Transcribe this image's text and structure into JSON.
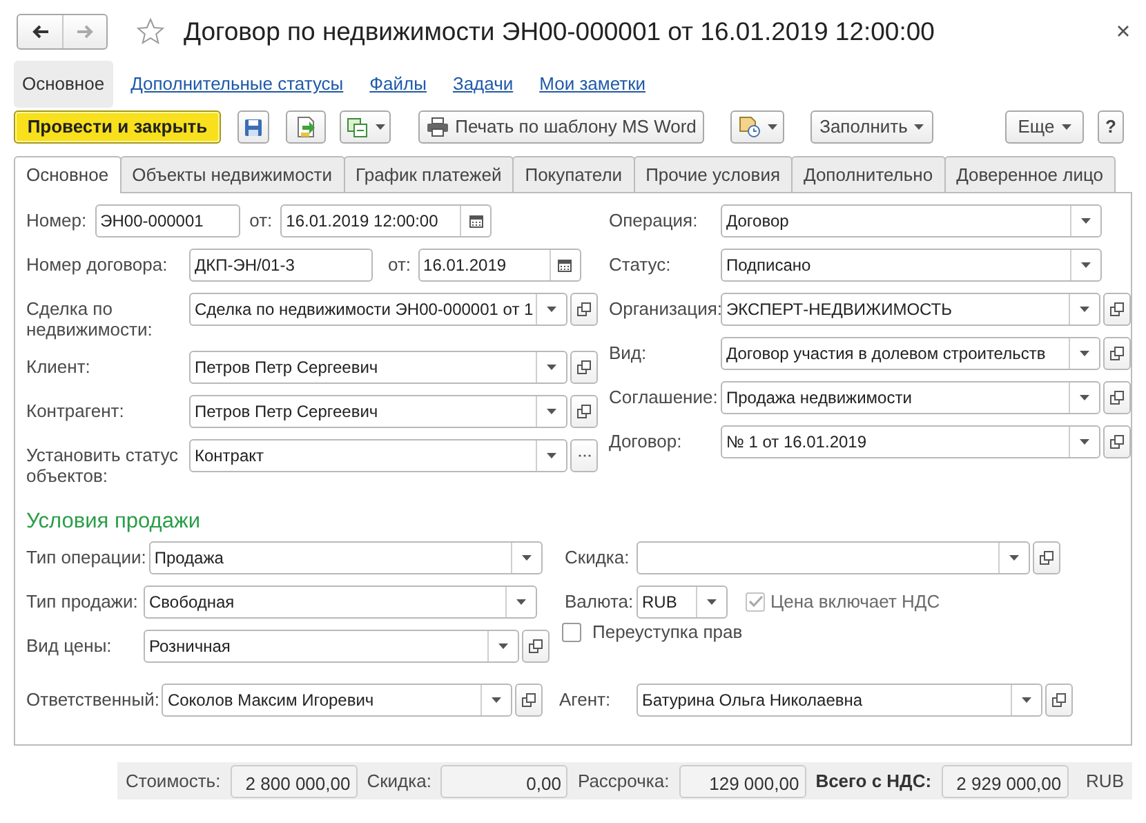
{
  "window": {
    "title": "Договор по недвижимости ЭН00-000001 от 16.01.2019 12:00:00"
  },
  "nav": [
    {
      "label": "Основное",
      "selected": true
    },
    {
      "label": "Дополнительные статусы",
      "selected": false
    },
    {
      "label": "Файлы",
      "selected": false
    },
    {
      "label": "Задачи",
      "selected": false
    },
    {
      "label": "Мои заметки",
      "selected": false
    }
  ],
  "toolbar": {
    "post_close": "Провести и закрыть",
    "print": "Печать по шаблону MS Word",
    "fill": "Заполнить",
    "more": "Еще",
    "help": "?"
  },
  "tabs": [
    {
      "label": "Основное",
      "selected": true
    },
    {
      "label": "Объекты недвижимости",
      "selected": false
    },
    {
      "label": "График платежей",
      "selected": false
    },
    {
      "label": "Покупатели",
      "selected": false
    },
    {
      "label": "Прочие условия",
      "selected": false
    },
    {
      "label": "Дополнительно",
      "selected": false
    },
    {
      "label": "Доверенное лицо",
      "selected": false
    }
  ],
  "main": {
    "left": [
      {
        "kind": "number_date",
        "label": "Номер:",
        "value": "ЭН00-000001",
        "date_label": "от:",
        "date": "16.01.2019 12:00:00"
      },
      {
        "kind": "number_date",
        "label": "Номер договора:",
        "value": "ДКП-ЭН/01-3",
        "date_label": "от:",
        "date": "16.01.2019"
      },
      {
        "kind": "select_open",
        "label": "Сделка по недвижимости:",
        "value": "Сделка по недвижимости ЭН00-000001 от 1"
      },
      {
        "kind": "select_open",
        "label": "Клиент:",
        "value": "Петров Петр Сергеевич"
      },
      {
        "kind": "select_open",
        "label": "Контрагент:",
        "value": "Петров Петр Сергеевич"
      },
      {
        "kind": "select_more",
        "label": "Установить статус объектов:",
        "value": "Контракт"
      }
    ],
    "right": [
      {
        "kind": "select",
        "label": "Операция:",
        "value": "Договор"
      },
      {
        "kind": "select",
        "label": "Статус:",
        "value": "Подписано"
      },
      {
        "kind": "select_open",
        "label": "Организация:",
        "value": "ЭКСПЕРТ-НЕДВИЖИМОСТЬ"
      },
      {
        "kind": "select_open",
        "label": "Вид:",
        "value": "Договор участия в долевом строительств"
      },
      {
        "kind": "select_open",
        "label": "Соглашение:",
        "value": "Продажа недвижимости"
      },
      {
        "kind": "select_open",
        "label": "Договор:",
        "value": "№ 1 от 16.01.2019"
      }
    ]
  },
  "sale_conditions": {
    "title": "Условия продажи",
    "rows": [
      {
        "left": {
          "kind": "select",
          "label": "Тип операции:",
          "value": "Продажа"
        },
        "right": {
          "kind": "select_open",
          "label": "Скидка:"
        }
      },
      {
        "left": {
          "kind": "select",
          "label": "Тип продажи:",
          "value": "Свободная"
        },
        "right": {
          "kind": "currency",
          "label": "Валюта:",
          "value": "RUB",
          "checkbox": {
            "label": "Цена включает НДС",
            "checked": true,
            "disabled": true
          }
        }
      },
      {
        "left": {
          "kind": "select_open",
          "label": "Вид цены:",
          "value": "Розничная"
        },
        "right": {
          "kind": "checkbox",
          "label": "Переуступка прав",
          "checked": false,
          "disabled": false
        }
      },
      {
        "left": {
          "kind": "select_open",
          "label": "Ответственный:",
          "value": "Соколов Максим Игоревич"
        },
        "right": {
          "kind": "select_open",
          "label": "Агент:",
          "value": "Батурина Ольга Николаевна"
        }
      }
    ]
  },
  "totals": {
    "items": [
      {
        "label": "Стоимость:",
        "value": "2 800 000,00",
        "bold": false
      },
      {
        "label": "Скидка:",
        "value": "0,00",
        "bold": false
      },
      {
        "label": "Рассрочка:",
        "value": "129 000,00",
        "bold": false
      },
      {
        "label": "Всего с НДС:",
        "value": "2 929 000,00",
        "bold": true
      }
    ],
    "currency": "RUB"
  }
}
